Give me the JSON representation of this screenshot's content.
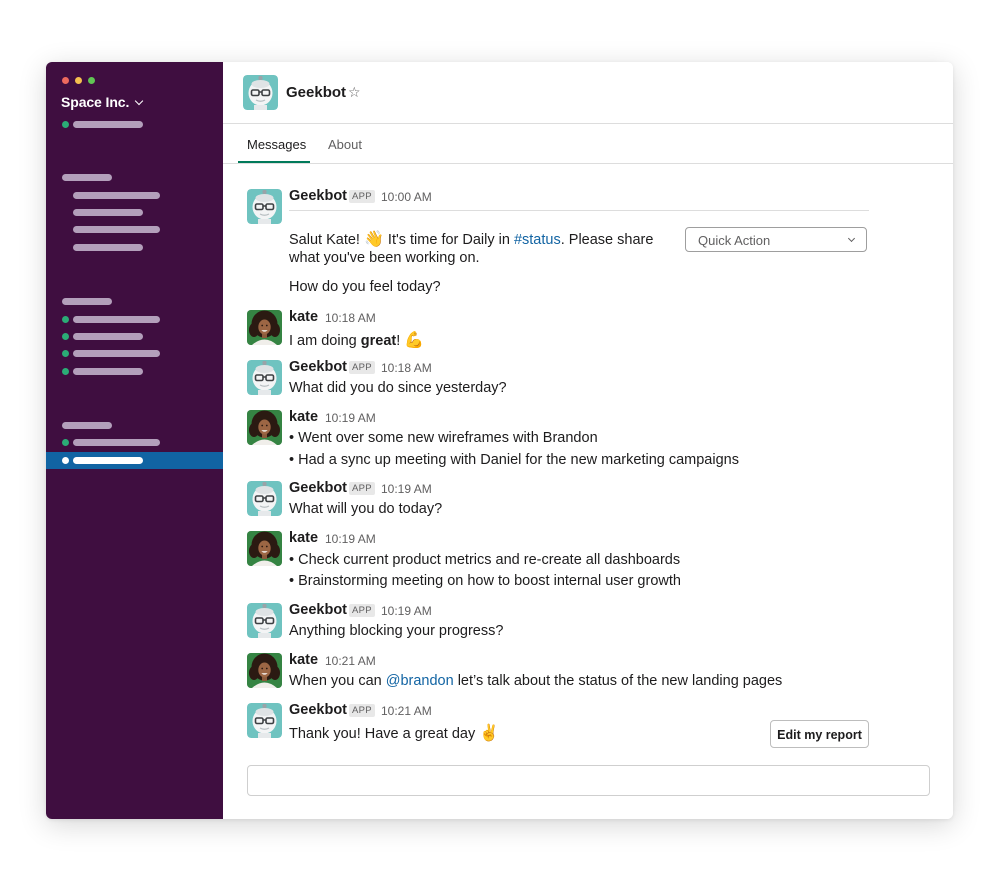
{
  "workspace": {
    "name": "Space Inc."
  },
  "channel": {
    "name": "Geekbot"
  },
  "tabs": [
    {
      "label": "Messages"
    },
    {
      "label": "About"
    }
  ],
  "badge": "APP",
  "colors": {
    "sidebar": "#3f0e40",
    "active": "#1164a3",
    "online": "#2bac76",
    "link": "#1264a3",
    "tab_underline": "#007a5a"
  },
  "messages": [
    {
      "author": "Geekbot",
      "time": "10:00 AM",
      "greet_pre": "Salut Kate! ",
      "greet_emoji": "👋",
      "greet_mid": " It's time for Daily in ",
      "greet_channel": "#status",
      "greet_post": ". Please share",
      "line2": "what you've been working on.",
      "question": "How do you feel today?",
      "quick_action": "Quick Action"
    },
    {
      "author": "kate",
      "time": "10:18 AM",
      "text_pre": "I am doing ",
      "text_bold": "great",
      "text_post": "! ",
      "emoji": "💪"
    },
    {
      "author": "Geekbot",
      "time": "10:18 AM",
      "text": "What did you do since yesterday?"
    },
    {
      "author": "kate",
      "time": "10:19 AM",
      "lines": [
        "• Went over some new wireframes with Brandon",
        "• Had a sync up meeting with Daniel for the new marketing campaigns"
      ]
    },
    {
      "author": "Geekbot",
      "time": "10:19 AM",
      "text": "What will you do today?"
    },
    {
      "author": "kate",
      "time": "10:19 AM",
      "lines": [
        "• Check current product metrics and re-create all dashboards",
        "• Brainstorming meeting on how to boost internal user growth"
      ]
    },
    {
      "author": "Geekbot",
      "time": "10:19 AM",
      "text": "Anything blocking your progress?"
    },
    {
      "author": "kate",
      "time": "10:21 AM",
      "text_pre": "When you can ",
      "mention": "@brandon",
      "text_post": " let’s talk about the status of the new landing pages"
    },
    {
      "author": "Geekbot",
      "time": "10:21 AM",
      "text": "Thank you! Have a great day ",
      "emoji": "✌️",
      "button": "Edit my report"
    }
  ]
}
